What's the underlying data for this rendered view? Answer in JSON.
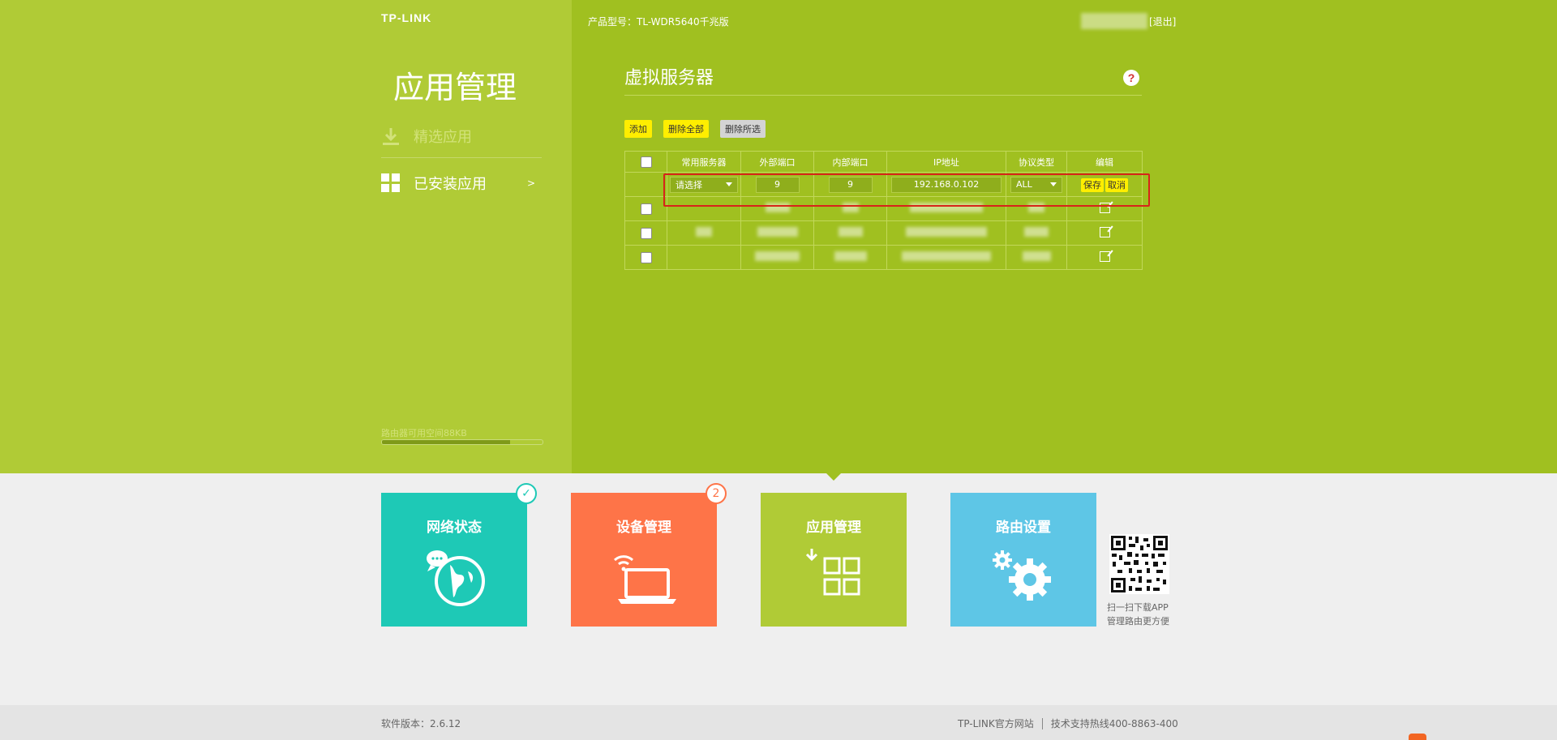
{
  "header": {
    "logo": "TP-LINK",
    "product": "产品型号：TL-WDR5640千兆版",
    "logout": "[退出]"
  },
  "sidebar": {
    "title": "应用管理",
    "items": [
      {
        "label": "精选应用",
        "icon": "download-icon"
      },
      {
        "label": "已安装应用",
        "icon": "grid-icon",
        "arrow": ">"
      }
    ],
    "space_label": "路由器可用空间88KB",
    "space_used_fraction": 0.8
  },
  "panel": {
    "title": "虚拟服务器",
    "help": "?",
    "buttons": {
      "add": "添加",
      "delete_all": "删除全部",
      "delete_selected": "删除所选"
    }
  },
  "table": {
    "headers": [
      "常用服务器",
      "外部端口",
      "内部端口",
      "IP地址",
      "协议类型",
      "编辑"
    ],
    "edit_row": {
      "service": "请选择",
      "external_port": "9",
      "internal_port": "9",
      "ip": "192.168.0.102",
      "protocol": "ALL",
      "save": "保存",
      "cancel": "取消"
    }
  },
  "tiles": [
    {
      "label": "网络状态",
      "color": "#1ec9b6"
    },
    {
      "label": "设备管理",
      "color": "#fe7448",
      "badge": "2"
    },
    {
      "label": "应用管理",
      "color": "#b0cb36"
    },
    {
      "label": "路由设置",
      "color": "#5ec6e6"
    }
  ],
  "qr": {
    "line1": "扫一扫下载APP",
    "line2": "管理路由更方便"
  },
  "footer": {
    "version": "软件版本：2.6.12",
    "site": "TP-LINK官方网站",
    "hotline": "技术支持热线400-8863-400"
  },
  "colors": {
    "accent": "#a0c020",
    "sidebar": "#b0cb36",
    "highlight": "#d7241a"
  }
}
